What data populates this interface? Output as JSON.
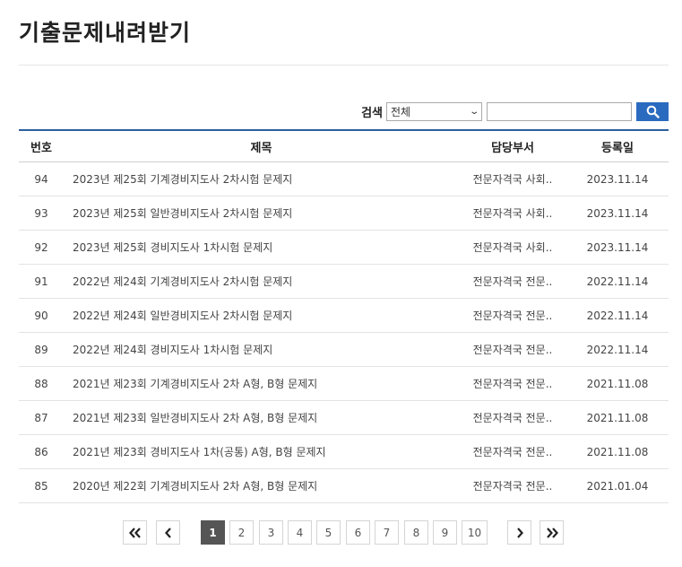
{
  "page": {
    "title": "기출문제내려받기"
  },
  "search": {
    "label": "검색",
    "select_value": "전체",
    "input_value": "",
    "accent": "#2b6bbf"
  },
  "table": {
    "headers": {
      "no": "번호",
      "title": "제목",
      "dept": "담당부서",
      "date": "등록일"
    },
    "rows": [
      {
        "no": "94",
        "title": "2023년 제25회 기계경비지도사 2차시험 문제지",
        "dept": "전문자격국 사회..",
        "date": "2023.11.14"
      },
      {
        "no": "93",
        "title": "2023년 제25회 일반경비지도사 2차시험 문제지",
        "dept": "전문자격국 사회..",
        "date": "2023.11.14"
      },
      {
        "no": "92",
        "title": "2023년 제25회 경비지도사 1차시험 문제지",
        "dept": "전문자격국 사회..",
        "date": "2023.11.14"
      },
      {
        "no": "91",
        "title": "2022년 제24회 기계경비지도사 2차시험 문제지",
        "dept": "전문자격국 전문..",
        "date": "2022.11.14"
      },
      {
        "no": "90",
        "title": "2022년 제24회 일반경비지도사 2차시험 문제지",
        "dept": "전문자격국 전문..",
        "date": "2022.11.14"
      },
      {
        "no": "89",
        "title": "2022년 제24회 경비지도사 1차시험 문제지",
        "dept": "전문자격국 전문..",
        "date": "2022.11.14"
      },
      {
        "no": "88",
        "title": "2021년 제23회 기계경비지도사 2차 A형, B형 문제지",
        "dept": "전문자격국 전문..",
        "date": "2021.11.08"
      },
      {
        "no": "87",
        "title": "2021년 제23회 일반경비지도사 2차 A형, B형 문제지",
        "dept": "전문자격국 전문..",
        "date": "2021.11.08"
      },
      {
        "no": "86",
        "title": "2021년 제23회 경비지도사 1차(공통) A형, B형 문제지",
        "dept": "전문자격국 전문..",
        "date": "2021.11.08"
      },
      {
        "no": "85",
        "title": "2020년 제22회 기계경비지도사 2차 A형, B형 문제지",
        "dept": "전문자격국 전문..",
        "date": "2021.01.04"
      }
    ]
  },
  "pagination": {
    "pages": [
      "1",
      "2",
      "3",
      "4",
      "5",
      "6",
      "7",
      "8",
      "9",
      "10"
    ],
    "current": "1"
  }
}
